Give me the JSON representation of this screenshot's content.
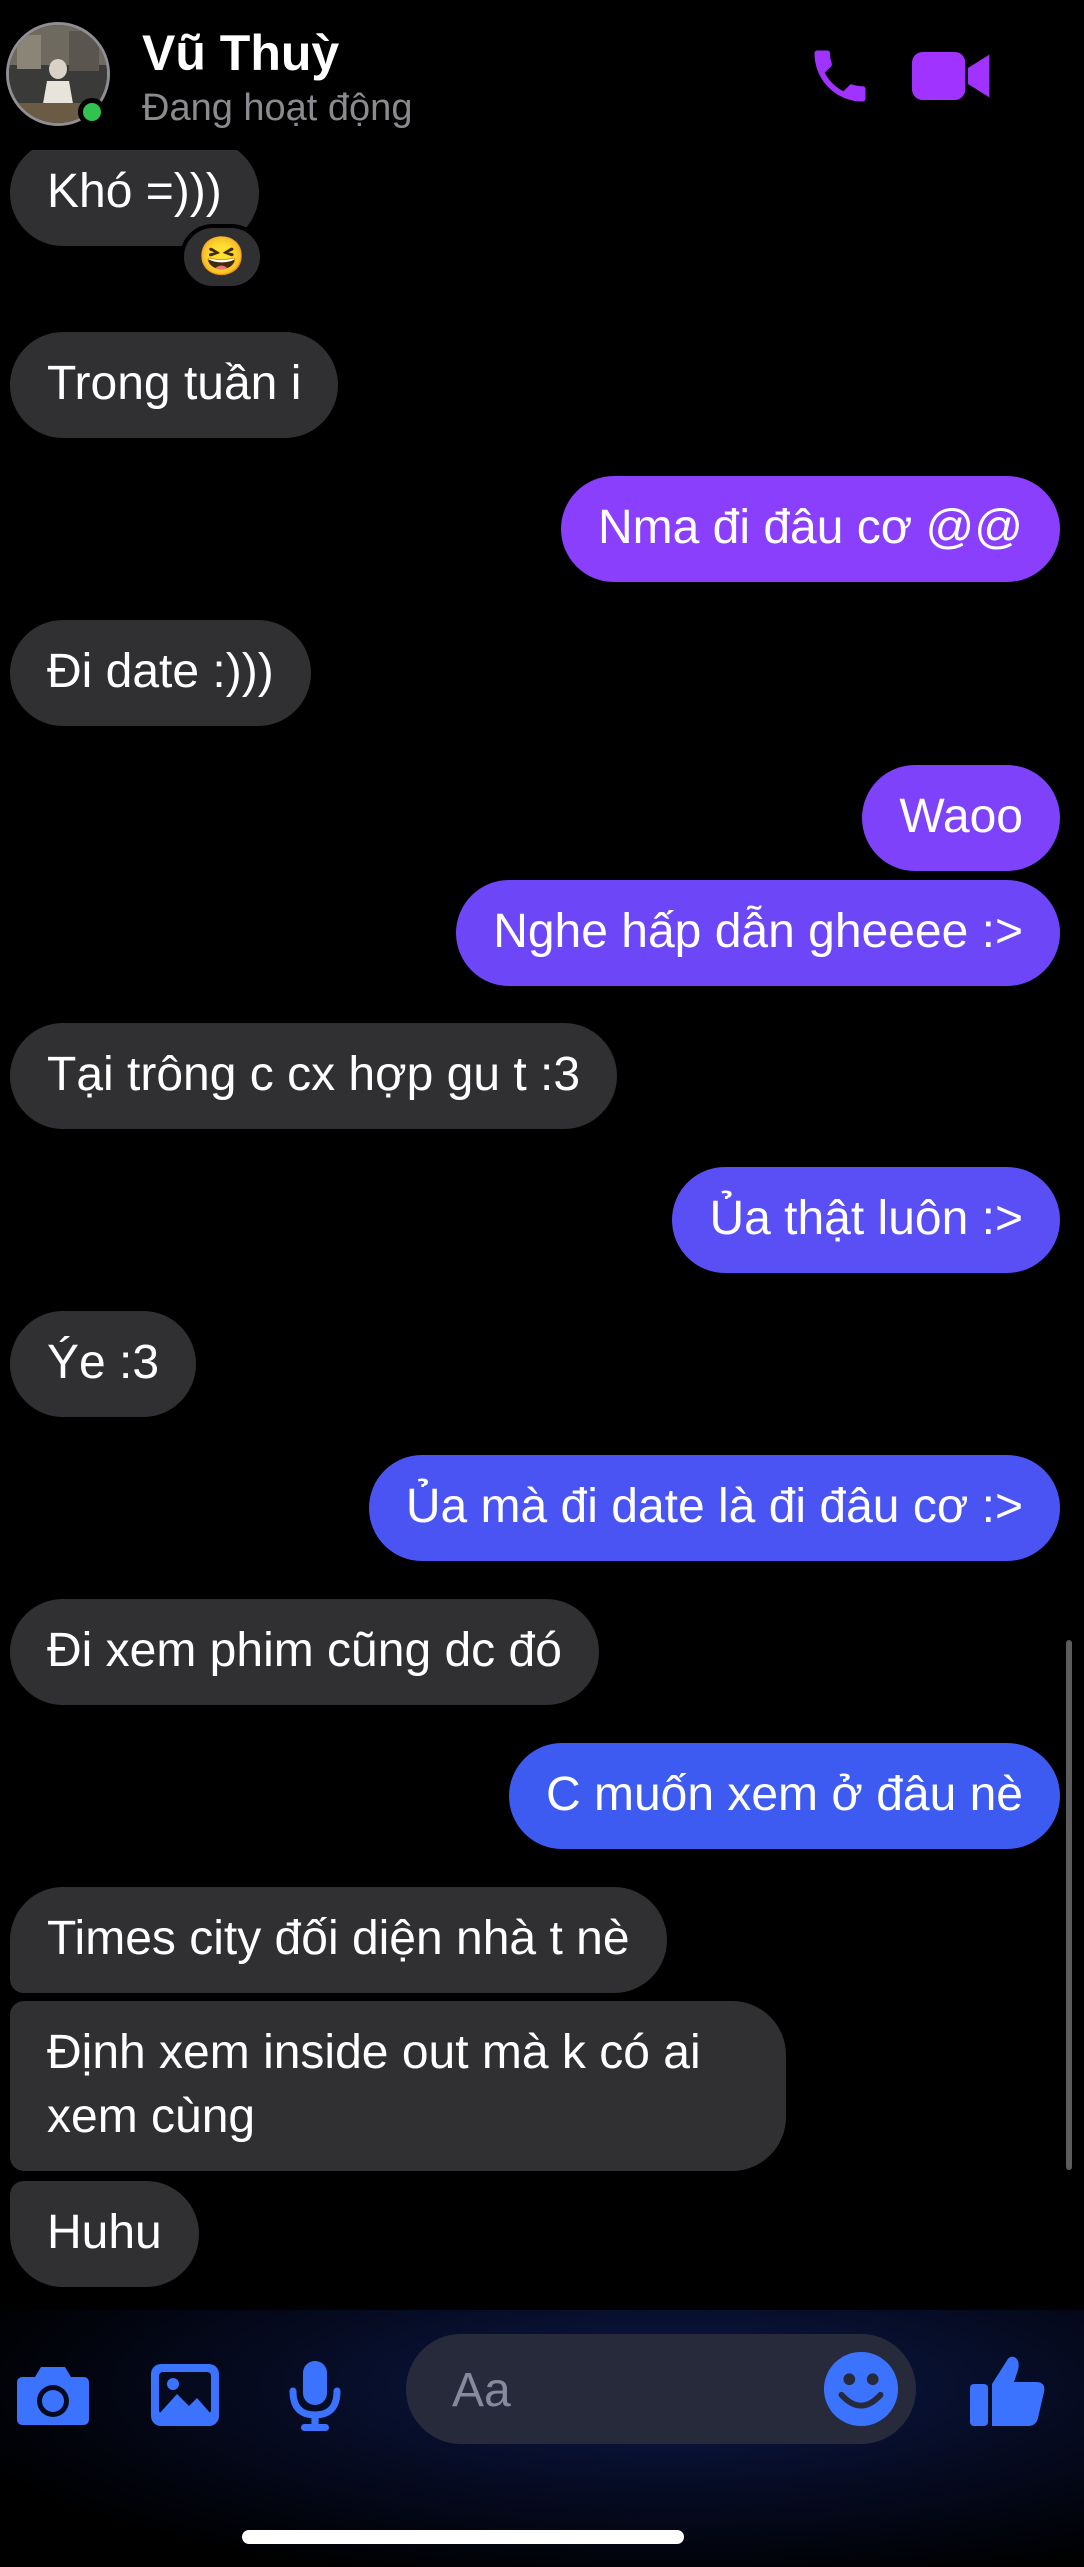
{
  "header": {
    "contact_name": "Vũ Thuỳ",
    "status": "Đang hoạt động",
    "online": true
  },
  "colors": {
    "accent": "#a033ff",
    "incoming_bubble": "#303032",
    "outgoing_purple": "#8a3ffc",
    "outgoing_blue": "#3d5af1",
    "composer_icons": "#3b73ff",
    "online_dot": "#31c24f"
  },
  "messages": [
    {
      "dir": "in",
      "text": "Khó =)))",
      "reaction": "😆"
    },
    {
      "dir": "in",
      "text": "Trong tuần i"
    },
    {
      "dir": "out",
      "text": "Nma đi đâu cơ @@"
    },
    {
      "dir": "in",
      "text": "Đi date :)))"
    },
    {
      "dir": "out",
      "text": "Waoo"
    },
    {
      "dir": "out",
      "text": "Nghe hấp dẫn gheeee :>"
    },
    {
      "dir": "in",
      "text": "Tại trông c cx hợp gu t :3"
    },
    {
      "dir": "out",
      "text": "Ủa thật luôn :>"
    },
    {
      "dir": "in",
      "text": "Ýe :3"
    },
    {
      "dir": "out",
      "text": "Ủa mà đi date là đi đâu cơ :>"
    },
    {
      "dir": "in",
      "text": "Đi xem phim cũng dc đó"
    },
    {
      "dir": "out",
      "text": "C muốn xem ở đâu nè"
    },
    {
      "dir": "in",
      "text": "Times city đối diện nhà t nè"
    },
    {
      "dir": "in",
      "text": "Định xem inside out mà k có ai xem cùng"
    },
    {
      "dir": "in",
      "text": "Huhu"
    }
  ],
  "composer": {
    "placeholder": "Aa",
    "value": "",
    "icons": [
      "camera-icon",
      "gallery-icon",
      "microphone-icon",
      "emoji-icon",
      "thumbs-up-icon"
    ]
  }
}
